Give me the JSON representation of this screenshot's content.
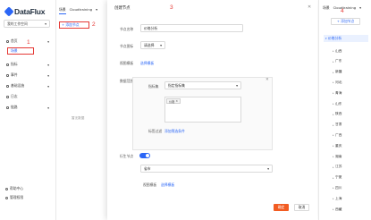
{
  "app": {
    "logo_text": "DataFlux"
  },
  "sidebar": {
    "workspace": "我的工作空间",
    "items": [
      {
        "label": "首页"
      },
      {
        "label": "场景"
      },
      {
        "label": "指标"
      },
      {
        "label": "事件"
      },
      {
        "label": "基础设施"
      },
      {
        "label": "日志"
      },
      {
        "label": "链路"
      }
    ],
    "bottom": [
      "帮助中心",
      "管理权限"
    ]
  },
  "column2": {
    "tabs": [
      "场景",
      "Cloudtraining"
    ],
    "add_node": "+ 添加节点",
    "empty": "暂无数据"
  },
  "modal": {
    "title": "创建节点",
    "node_name_label": "节点名称",
    "node_name_value": "价格分析",
    "node_icon_label": "节点图标",
    "node_icon_value": "请选择",
    "view_template_label": "视图模板",
    "view_template_link": "选择模板",
    "data_scope_label": "数据范围",
    "metric_label": "指标集",
    "metric_value": "指定指标集",
    "tag_value": "价格",
    "filter_label": "标签过滤",
    "filter_link": "添加筛选条件",
    "child_node_label": "衍生节点",
    "child_metric_value": "省市",
    "child_view_label": "视图模板",
    "child_view_link": "选择模板",
    "confirm": "确定",
    "cancel": "取消"
  },
  "right_panel": {
    "tabs": [
      "场景",
      "Cloudtraining"
    ],
    "add_node": "+ 添加节点",
    "root": "价格分析",
    "items": [
      "山西",
      "广东",
      "新疆",
      "河北",
      "青海",
      "山东",
      "陕西",
      "甘肃",
      "广西",
      "重庆",
      "湖南",
      "江苏",
      "宁夏",
      "四川",
      "上海",
      "西藏"
    ]
  },
  "annotations": [
    "1",
    "2",
    "3",
    "4"
  ],
  "colors": {
    "accent": "#2b66f6",
    "annotation": "#e53935",
    "confirm": "#f25c22"
  }
}
